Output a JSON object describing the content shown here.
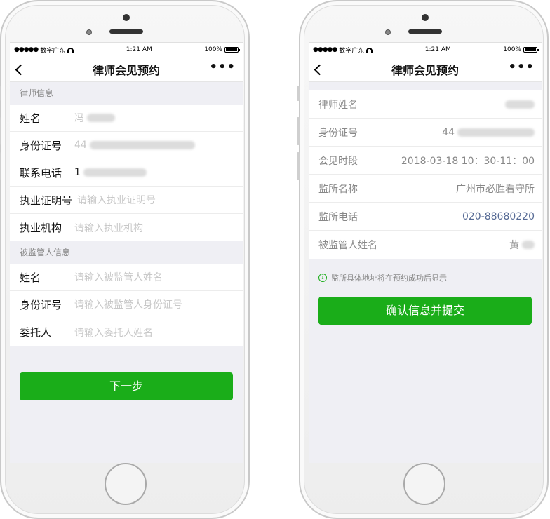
{
  "status": {
    "carrier": "数字广东",
    "time": "1:21 AM",
    "battery": "100%"
  },
  "left": {
    "title": "律师会见预约",
    "lawyer_section": "律师信息",
    "lawyer_rows": [
      {
        "label": "姓名",
        "value": "冯",
        "placeholder": ""
      },
      {
        "label": "身份证号",
        "value": "44",
        "placeholder": ""
      },
      {
        "label": "联系电话",
        "value": "1",
        "placeholder": ""
      },
      {
        "label": "执业证明号",
        "value": "",
        "placeholder": "请输入执业证明号"
      },
      {
        "label": "执业机构",
        "value": "",
        "placeholder": "请输入执业机构"
      }
    ],
    "detainee_section": "被监管人信息",
    "detainee_rows": [
      {
        "label": "姓名",
        "placeholder": "请输入被监管人姓名"
      },
      {
        "label": "身份证号",
        "placeholder": "请输入被监管人身份证号"
      },
      {
        "label": "委托人",
        "placeholder": "请输入委托人姓名"
      }
    ],
    "next_button": "下一步"
  },
  "right": {
    "title": "律师会见预约",
    "rows": [
      {
        "label": "律师姓名",
        "value": ""
      },
      {
        "label": "身份证号",
        "value": "44"
      },
      {
        "label": "会见时段",
        "value": "2018-03-18 10：30-11：00"
      },
      {
        "label": "监所名称",
        "value": "广州市必胜看守所"
      },
      {
        "label": "监所电话",
        "value": "020-88680220"
      },
      {
        "label": "被监管人姓名",
        "value": "黄"
      }
    ],
    "notice": "监所具体地址将在预约成功后显示",
    "confirm_button": "确认信息并提交"
  },
  "colors": {
    "primary_green": "#1aad19",
    "link_blue": "#576b95",
    "background": "#efeff4"
  },
  "icons": [
    "back-chevron-icon",
    "more-icon",
    "wifi-icon",
    "battery-icon",
    "info-icon"
  ]
}
